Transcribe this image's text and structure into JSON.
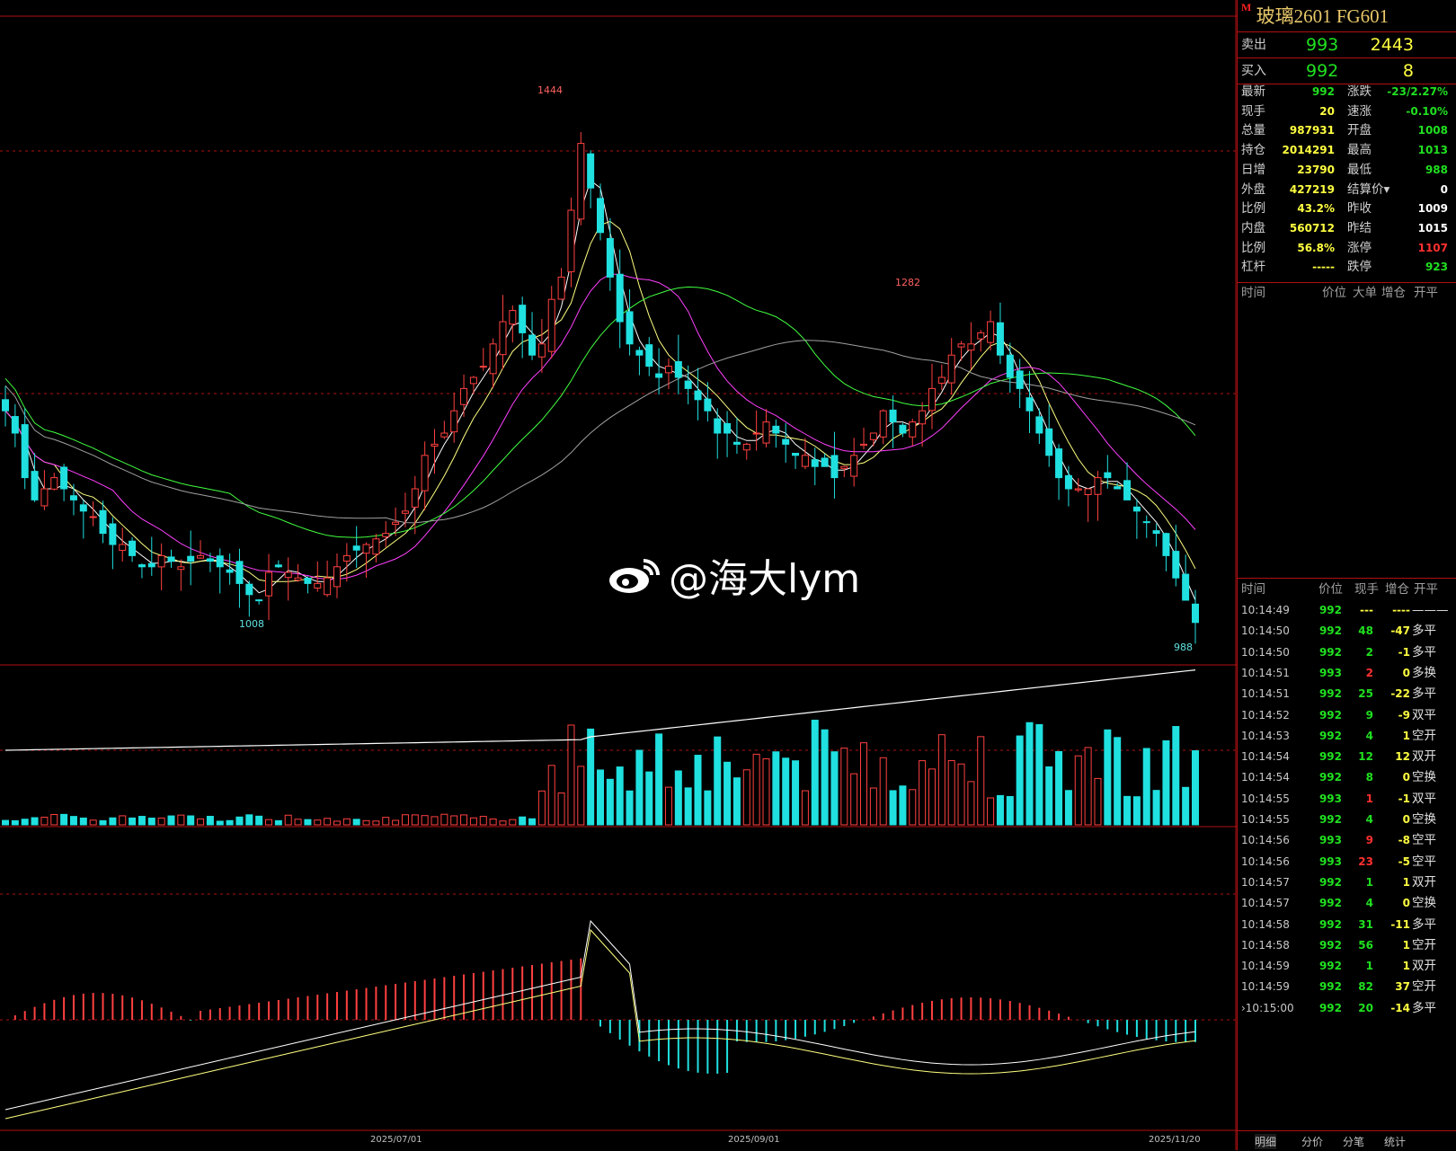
{
  "instrument": {
    "marker": "M",
    "name": "玻璃2601  FG601"
  },
  "quote": {
    "ask_label": "卖出",
    "ask_price": "993",
    "ask_qty": "2443",
    "bid_label": "买入",
    "bid_price": "992",
    "bid_qty": "8"
  },
  "stats": [
    {
      "l1": "最新",
      "v1": "992",
      "c1": "#20e020",
      "l2": "涨跌",
      "v2": "-23/2.27%",
      "c2": "#20e020"
    },
    {
      "l1": "现手",
      "v1": "20",
      "c1": "#ffff40",
      "l2": "速涨",
      "v2": "-0.10%",
      "c2": "#20e020"
    },
    {
      "l1": "总量",
      "v1": "987931",
      "c1": "#ffff40",
      "l2": "开盘",
      "v2": "1008",
      "c2": "#20e020"
    },
    {
      "l1": "持仓",
      "v1": "2014291",
      "c1": "#ffff40",
      "l2": "最高",
      "v2": "1013",
      "c2": "#20e020"
    },
    {
      "l1": "日增",
      "v1": "23790",
      "c1": "#ffff40",
      "l2": "最低",
      "v2": "988",
      "c2": "#20e020"
    },
    {
      "l1": "外盘",
      "v1": "427219",
      "c1": "#ffff40",
      "l2": "结算价▾",
      "v2": "0",
      "c2": "#ffffff"
    },
    {
      "l1": "比例",
      "v1": "43.2%",
      "c1": "#ffff40",
      "l2": "昨收",
      "v2": "1009",
      "c2": "#ffffff"
    },
    {
      "l1": "内盘",
      "v1": "560712",
      "c1": "#ffff40",
      "l2": "昨结",
      "v2": "1015",
      "c2": "#ffffff"
    },
    {
      "l1": "比例",
      "v1": "56.8%",
      "c1": "#ffff40",
      "l2": "涨停",
      "v2": "1107",
      "c2": "#ff3030"
    },
    {
      "l1": "杠杆",
      "v1": "-----",
      "c1": "#ffff40",
      "l2": "跌停",
      "v2": "923",
      "c2": "#20e020"
    }
  ],
  "big_orders_header": {
    "time": "时间",
    "price": "价位",
    "big": "大单",
    "inc": "增仓",
    "type": "开平"
  },
  "ticks_header": {
    "time": "时间",
    "price": "价位",
    "vol": "现手",
    "inc": "增仓",
    "type": "开平"
  },
  "ticks": [
    {
      "time": "10:14:49",
      "price": "992",
      "pc": "#20e020",
      "vol": "---",
      "vc": "#ffff40",
      "inc": "----",
      "ic": "#ffff40",
      "type": "———"
    },
    {
      "time": "10:14:50",
      "price": "992",
      "pc": "#20e020",
      "vol": "48",
      "vc": "#20e020",
      "inc": "-47",
      "ic": "#ffff40",
      "type": "多平"
    },
    {
      "time": "10:14:50",
      "price": "992",
      "pc": "#20e020",
      "vol": "2",
      "vc": "#20e020",
      "inc": "-1",
      "ic": "#ffff40",
      "type": "多平"
    },
    {
      "time": "10:14:51",
      "price": "993",
      "pc": "#20e020",
      "vol": "2",
      "vc": "#ff3030",
      "inc": "0",
      "ic": "#ffff40",
      "type": "多换"
    },
    {
      "time": "10:14:51",
      "price": "992",
      "pc": "#20e020",
      "vol": "25",
      "vc": "#20e020",
      "inc": "-22",
      "ic": "#ffff40",
      "type": "多平"
    },
    {
      "time": "10:14:52",
      "price": "992",
      "pc": "#20e020",
      "vol": "9",
      "vc": "#20e020",
      "inc": "-9",
      "ic": "#ffff40",
      "type": "双平"
    },
    {
      "time": "10:14:53",
      "price": "992",
      "pc": "#20e020",
      "vol": "4",
      "vc": "#20e020",
      "inc": "1",
      "ic": "#ffff40",
      "type": "空开"
    },
    {
      "time": "10:14:54",
      "price": "992",
      "pc": "#20e020",
      "vol": "12",
      "vc": "#20e020",
      "inc": "12",
      "ic": "#ffff40",
      "type": "双开"
    },
    {
      "time": "10:14:54",
      "price": "992",
      "pc": "#20e020",
      "vol": "8",
      "vc": "#20e020",
      "inc": "0",
      "ic": "#ffff40",
      "type": "空换"
    },
    {
      "time": "10:14:55",
      "price": "993",
      "pc": "#20e020",
      "vol": "1",
      "vc": "#ff3030",
      "inc": "-1",
      "ic": "#ffff40",
      "type": "双平"
    },
    {
      "time": "10:14:55",
      "price": "992",
      "pc": "#20e020",
      "vol": "4",
      "vc": "#20e020",
      "inc": "0",
      "ic": "#ffff40",
      "type": "空换"
    },
    {
      "time": "10:14:56",
      "price": "993",
      "pc": "#20e020",
      "vol": "9",
      "vc": "#ff3030",
      "inc": "-8",
      "ic": "#ffff40",
      "type": "空平"
    },
    {
      "time": "10:14:56",
      "price": "993",
      "pc": "#20e020",
      "vol": "23",
      "vc": "#ff3030",
      "inc": "-5",
      "ic": "#ffff40",
      "type": "空平"
    },
    {
      "time": "10:14:57",
      "price": "992",
      "pc": "#20e020",
      "vol": "1",
      "vc": "#20e020",
      "inc": "1",
      "ic": "#ffff40",
      "type": "双开"
    },
    {
      "time": "10:14:57",
      "price": "992",
      "pc": "#20e020",
      "vol": "4",
      "vc": "#20e020",
      "inc": "0",
      "ic": "#ffff40",
      "type": "空换"
    },
    {
      "time": "10:14:58",
      "price": "992",
      "pc": "#20e020",
      "vol": "31",
      "vc": "#20e020",
      "inc": "-11",
      "ic": "#ffff40",
      "type": "多平"
    },
    {
      "time": "10:14:58",
      "price": "992",
      "pc": "#20e020",
      "vol": "56",
      "vc": "#20e020",
      "inc": "1",
      "ic": "#ffff40",
      "type": "空开"
    },
    {
      "time": "10:14:59",
      "price": "992",
      "pc": "#20e020",
      "vol": "1",
      "vc": "#20e020",
      "inc": "1",
      "ic": "#ffff40",
      "type": "双开"
    },
    {
      "time": "10:14:59",
      "price": "992",
      "pc": "#20e020",
      "vol": "82",
      "vc": "#20e020",
      "inc": "37",
      "ic": "#ffff40",
      "type": "空开"
    },
    {
      "time": "›10:15:00",
      "price": "992",
      "pc": "#20e020",
      "vol": "20",
      "vc": "#20e020",
      "inc": "-14",
      "ic": "#ffff40",
      "type": "多平"
    }
  ],
  "tabs": [
    "明细",
    "分价",
    "分笔",
    "统计"
  ],
  "watermark": "@海大lym",
  "colors": {
    "up": "#ff4040",
    "down": "#20e0e0",
    "grid": "#b01010"
  },
  "chart_data": {
    "type": "candlestick",
    "x_labels": [
      "2025/07/01",
      "2025/09/01",
      "2025/11/20"
    ],
    "annotations": {
      "high": "1444",
      "mid_high": "1282",
      "low": "1008",
      "last_low": "988"
    },
    "closes": [
      1180,
      1160,
      1120,
      1100,
      1110,
      1120,
      1110,
      1100,
      1090,
      1085,
      1070,
      1060,
      1060,
      1050,
      1040,
      1040,
      1050,
      1045,
      1040,
      1045,
      1050,
      1045,
      1040,
      1035,
      1025,
      1015,
      1010,
      1035,
      1040,
      1035,
      1030,
      1025,
      1025,
      1030,
      1040,
      1050,
      1055,
      1060,
      1065,
      1070,
      1080,
      1090,
      1110,
      1140,
      1150,
      1160,
      1180,
      1200,
      1210,
      1220,
      1240,
      1260,
      1270,
      1250,
      1230,
      1240,
      1280,
      1300,
      1360,
      1420,
      1380,
      1340,
      1300,
      1260,
      1240,
      1230,
      1220,
      1210,
      1220,
      1210,
      1200,
      1190,
      1180,
      1160,
      1160,
      1150,
      1150,
      1160,
      1170,
      1160,
      1150,
      1140,
      1140,
      1130,
      1130,
      1120,
      1130,
      1140,
      1150,
      1160,
      1180,
      1170,
      1160,
      1170,
      1180,
      1200,
      1210,
      1230,
      1240,
      1240,
      1250,
      1260,
      1230,
      1210,
      1200,
      1180,
      1160,
      1140,
      1120,
      1110,
      1110,
      1110,
      1120,
      1120,
      1110,
      1100,
      1090,
      1080,
      1070,
      1050,
      1030,
      1010,
      990
    ],
    "ma_series": [
      "MA5",
      "MA10",
      "MA20",
      "MA40",
      "MA60"
    ]
  }
}
